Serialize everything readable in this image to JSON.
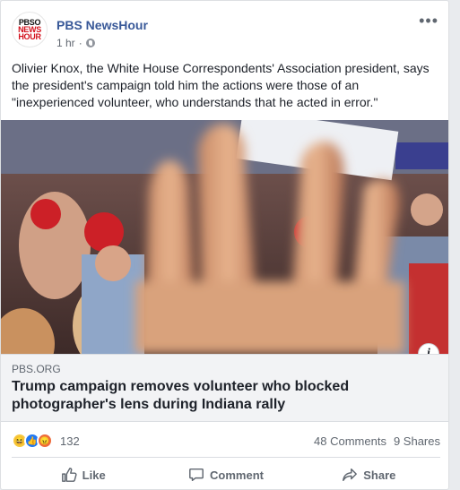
{
  "post": {
    "page_name": "PBS NewsHour",
    "logo": {
      "line1": "PBSO",
      "line2": "NEWS",
      "line3": "HOUR"
    },
    "time": "1 hr",
    "privacy_icon": "globe-icon",
    "more_label": "•••",
    "caption": "Olivier Knox, the White House Correspondents' Association president, says the president's campaign told him the actions were those of an \"inexperienced volunteer, who understands that he acted in error.\""
  },
  "link": {
    "domain": "PBS.ORG",
    "title": "Trump campaign removes volunteer who blocked photographer's lens during Indiana rally",
    "info_label": "i"
  },
  "stats": {
    "reactions": [
      "haha",
      "like",
      "angry"
    ],
    "reaction_count": "132",
    "comments": "48 Comments",
    "shares": "9 Shares"
  },
  "actions": {
    "like": "Like",
    "comment": "Comment",
    "share": "Share"
  },
  "colors": {
    "link_blue": "#385898",
    "text": "#1d2129",
    "muted": "#606770",
    "pbs_red": "#d3101b"
  }
}
